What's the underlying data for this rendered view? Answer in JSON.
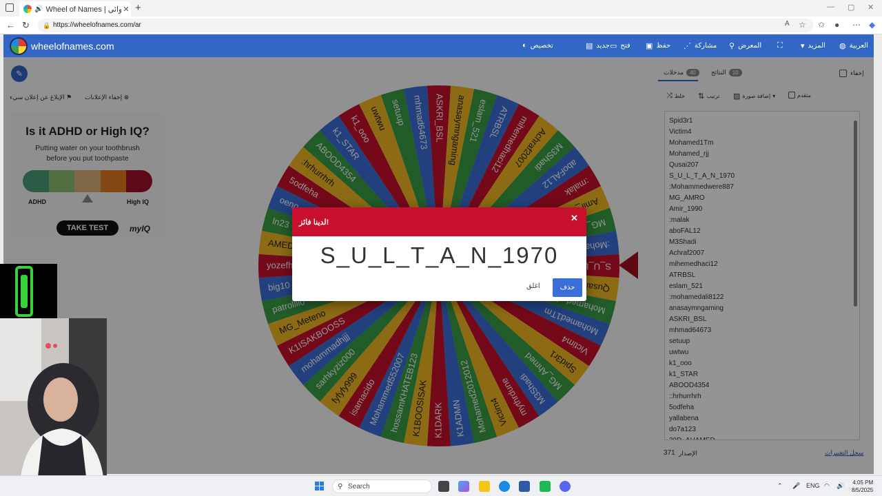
{
  "browser": {
    "tab_title": "Wheel of Names | العشوائي ...",
    "url": "https://wheelofnames.com/ar"
  },
  "header": {
    "brand": "wheelofnames.com",
    "menu": [
      {
        "label": "تخصيص",
        "icon": "palette-icon"
      },
      {
        "label": "جديد",
        "icon": "new-file-icon"
      },
      {
        "label": "فتح",
        "icon": "folder-icon"
      },
      {
        "label": "حفظ",
        "icon": "save-icon"
      },
      {
        "label": "مشاركة",
        "icon": "share-icon"
      },
      {
        "label": "المعرض",
        "icon": "search-icon"
      },
      {
        "label": "",
        "icon": "fullscreen-icon"
      },
      {
        "label": "المزيد",
        "icon": "chevron-down-icon"
      },
      {
        "label": "العربية",
        "icon": "globe-icon"
      }
    ]
  },
  "adbar": {
    "report": "الإبلاغ عن إعلان سيء",
    "hide": "إخفاء الإعلانات"
  },
  "ad": {
    "title": "Is it ADHD or High IQ?",
    "subtitle": "Putting water on your toothbrush before you put toothpaste",
    "left_label": "ADHD",
    "right_label": "High IQ",
    "button": "TAKE TEST",
    "brand": "myIQ",
    "colors": [
      "#4a9d78",
      "#8cbf72",
      "#d7b27a",
      "#e07b22",
      "#a3102e"
    ]
  },
  "panel": {
    "hide_label": "إخفاء",
    "entries_tab": "مدخلات",
    "entries_count": "40",
    "results_tab": "النتائج",
    "results_count": "10",
    "shuffle": "خلط",
    "sort": "ترتيب",
    "add_image": "إضافة صورة",
    "advanced": "متقدم",
    "version_label": "الإصدار",
    "version": "371",
    "changelog": "سجل التغييرات"
  },
  "entries": [
    "Spid3r1",
    "Victim4",
    "Mohamed1Tm",
    "Mohamed_rjj",
    "Qusai207",
    "S_U_L_T_A_N_1970",
    ":Mohammedwere887",
    "MG_AMRO",
    "Amir_1990",
    ":malak",
    "aboFAL12",
    "M3Shadi",
    "Achraf2007",
    "mihemedhaci12",
    "ATRBSL",
    "eslam_521",
    ":mohamedali8122",
    "anasaymngaming",
    "ASKRI_BSL",
    "mhmad64673",
    "setuup",
    "uwtwu",
    "k1_ooo",
    "k1_STAR",
    "ABOOD4354",
    "::hrhurrhrh",
    "5odfeha",
    "yallabena",
    "do7a123",
    "30D_AHAMED"
  ],
  "wheel": {
    "colors": [
      "#c8102e",
      "#f2b824",
      "#3a9e46",
      "#3b6fd8"
    ],
    "labels": [
      "S_U_L_T_A_N_1970",
      "Qusai207",
      "Mohamed_rjj",
      "Mohamed1Tm",
      "Victim4",
      "Spid3r1",
      "MG_Ahmed",
      "M3Shadi",
      "mythrdune",
      "Victim4",
      "Mohamed2012012",
      "K1ADMN",
      "K1DARK",
      "K1BOOSISAK",
      "hossamKHATEB123",
      "Mohammed552007",
      "isamacido",
      "fyfyfy999",
      "sarhkyziz000",
      "mohammadhjjj",
      "K1ISAKBOOSS",
      "MG_Meteno",
      "patrolllio",
      "big10",
      "yozefh",
      "AMED",
      "ln23",
      "oeno",
      "5odfeha",
      ":hrhurrhrh",
      "ABOOD4354",
      "k1_STAR",
      "k1_ooo",
      "uwtwu",
      "setuup",
      "mhmad64673",
      "ASKRI_BSL",
      "anasaymngaming",
      "eslam_521",
      "ATRBSL",
      "mihemedhaci12",
      "Achraf2007",
      "M3Shadi",
      "aboFAL12",
      ":malak",
      "Amir_1990",
      "MG_AMRO",
      ":Mohammedwere887"
    ]
  },
  "dialog": {
    "title": "لدينا فائز!",
    "winner": "S_U_L_T_A_N_1970",
    "close_label": "اغلق",
    "remove_label": "حذف"
  },
  "taskbar": {
    "search": "Search",
    "lang": "ENG",
    "time": "4:05 PM",
    "date": "8/5/2025"
  }
}
